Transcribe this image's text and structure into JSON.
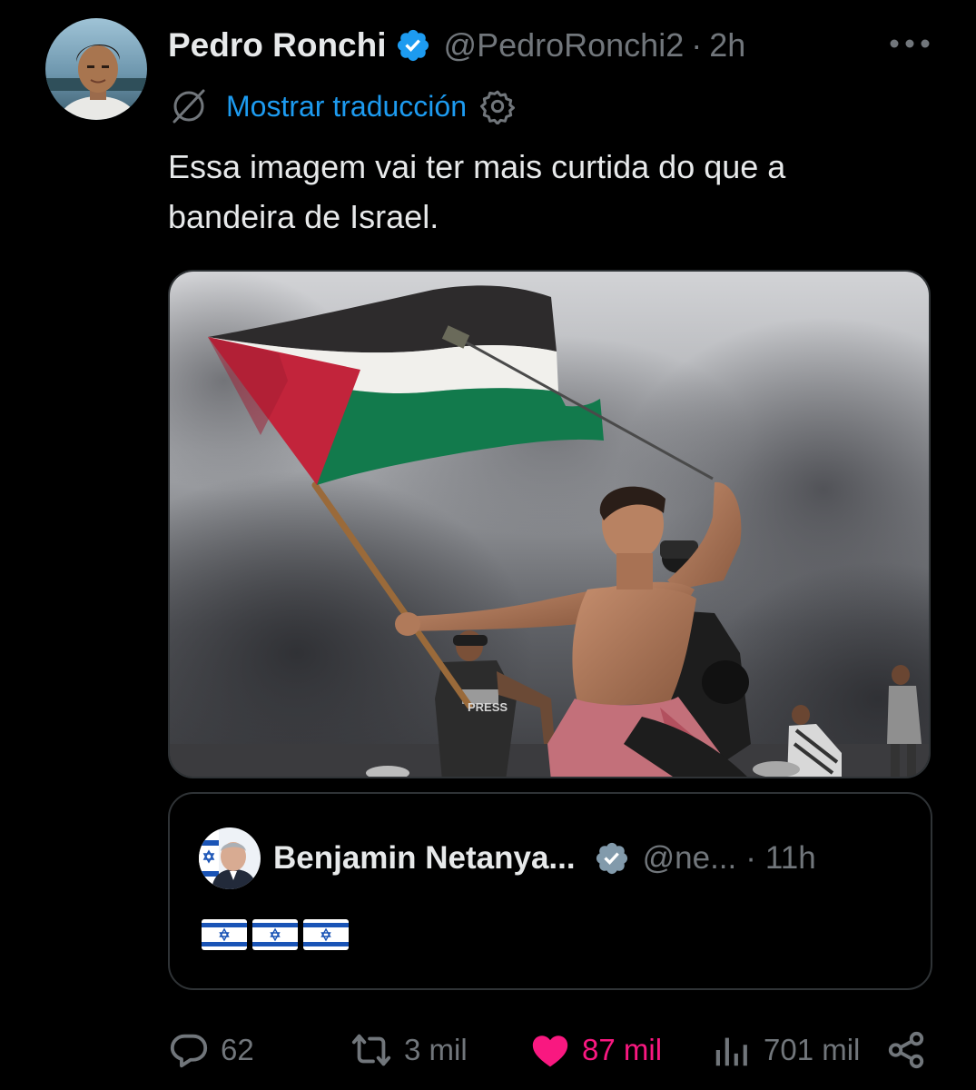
{
  "tweet": {
    "author": {
      "display_name": "Pedro Ronchi",
      "handle": "@PedroRonchi2",
      "separator": "·",
      "time": "2h",
      "verified": true
    },
    "translate": {
      "label": "Mostrar traducción"
    },
    "text": "Essa imagem vai ter mais curtida do que a bandeira de Israel.",
    "media": {
      "kind": "photo",
      "overlay_text": "PRESS"
    },
    "quote": {
      "display_name": "Benjamin Netanya...",
      "handle": "@ne...",
      "separator": "·",
      "time": "11h",
      "verified": true,
      "flags": [
        "israel-flag",
        "israel-flag",
        "israel-flag"
      ]
    },
    "actions": {
      "replies": "62",
      "reposts": "3 mil",
      "likes": "87 mil",
      "views": "701 mil"
    }
  },
  "colors": {
    "background": "#000000",
    "text_primary": "#e7e9ea",
    "text_secondary": "#71767b",
    "link": "#1d9bf0",
    "verified_badge": "#1d9bf0",
    "quote_verified_badge": "#829aab",
    "like": "#f91880",
    "border": "#2f3336"
  },
  "icons": {
    "more": "more-dots-icon",
    "translate": "translate-globe-icon",
    "settings": "gear-icon",
    "reply": "reply-bubble-icon",
    "repost": "repost-arrows-icon",
    "like": "heart-filled-icon",
    "views": "views-bars-icon",
    "share": "share-icon"
  }
}
